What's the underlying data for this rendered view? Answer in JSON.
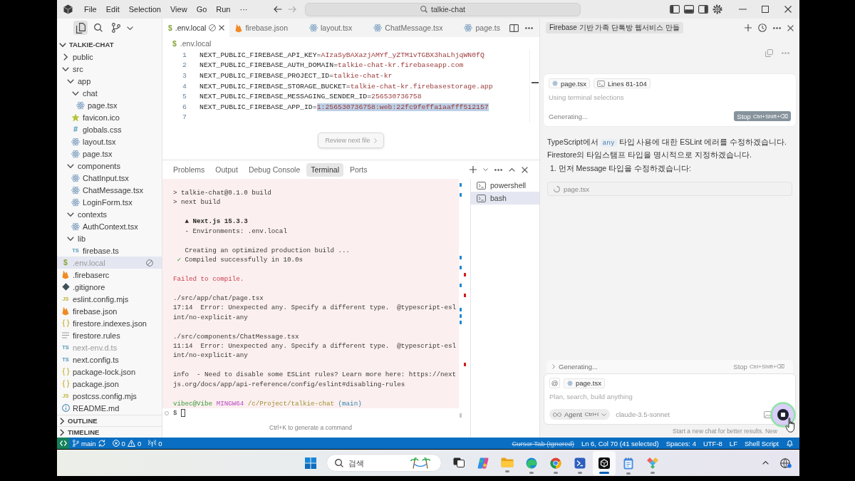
{
  "title_bar": {
    "menus": [
      "File",
      "Edit",
      "Selection",
      "View",
      "Go",
      "Run",
      "···"
    ],
    "command_center": {
      "label": "talkie-chat"
    }
  },
  "sidebar": {
    "views": [
      {
        "kind": "files",
        "selected": true
      },
      {
        "kind": "search",
        "selected": false
      },
      {
        "kind": "source-control",
        "selected": false
      }
    ],
    "explorer": {
      "title": "TALKIE-CHAT",
      "expanded": true,
      "items": [
        {
          "name": "public",
          "kind": "folder",
          "expanded": false,
          "selected": false,
          "dimmed": false,
          "blocked": false
        },
        {
          "name": "src",
          "kind": "folder",
          "expanded": true,
          "selected": false,
          "dimmed": false,
          "blocked": false,
          "children": [
            {
              "name": "app",
              "kind": "folder",
              "expanded": true,
              "selected": false,
              "dimmed": false,
              "blocked": false,
              "children": [
                {
                  "name": "chat",
                  "kind": "folder",
                  "expanded": true,
                  "selected": false,
                  "dimmed": false,
                  "blocked": false,
                  "children": [
                    {
                      "name": "page.tsx",
                      "kind": "react",
                      "selected": false,
                      "dimmed": false,
                      "blocked": false
                    }
                  ]
                },
                {
                  "name": "favicon.ico",
                  "kind": "star",
                  "selected": false,
                  "dimmed": false,
                  "blocked": false
                },
                {
                  "name": "globals.css",
                  "kind": "css",
                  "glyph": "#",
                  "selected": false,
                  "dimmed": false,
                  "blocked": false
                },
                {
                  "name": "layout.tsx",
                  "kind": "react",
                  "selected": false,
                  "dimmed": false,
                  "blocked": false
                },
                {
                  "name": "page.tsx",
                  "kind": "react",
                  "selected": false,
                  "dimmed": false,
                  "blocked": false
                }
              ]
            },
            {
              "name": "components",
              "kind": "folder",
              "expanded": true,
              "selected": false,
              "dimmed": false,
              "blocked": false,
              "children": [
                {
                  "name": "ChatInput.tsx",
                  "kind": "react",
                  "selected": false,
                  "dimmed": false,
                  "blocked": false
                },
                {
                  "name": "ChatMessage.tsx",
                  "kind": "react",
                  "selected": false,
                  "dimmed": false,
                  "blocked": false
                },
                {
                  "name": "LoginForm.tsx",
                  "kind": "react",
                  "selected": false,
                  "dimmed": false,
                  "blocked": false
                }
              ]
            },
            {
              "name": "contexts",
              "kind": "folder",
              "expanded": true,
              "selected": false,
              "dimmed": false,
              "blocked": false,
              "children": [
                {
                  "name": "AuthContext.tsx",
                  "kind": "react",
                  "selected": false,
                  "dimmed": false,
                  "blocked": false
                }
              ]
            },
            {
              "name": "lib",
              "kind": "folder",
              "expanded": true,
              "selected": false,
              "dimmed": false,
              "blocked": false,
              "children": [
                {
                  "name": "firebase.ts",
                  "kind": "ts",
                  "glyph": "TS",
                  "selected": false,
                  "dimmed": false,
                  "blocked": false
                }
              ]
            }
          ]
        },
        {
          "name": ".env.local",
          "kind": "env",
          "glyph": "$",
          "selected": true,
          "dimmed": true,
          "blocked": true
        },
        {
          "name": ".firebaserc",
          "kind": "firebase",
          "selected": false,
          "dimmed": false,
          "blocked": false
        },
        {
          "name": ".gitignore",
          "kind": "git",
          "selected": false,
          "dimmed": false,
          "blocked": false
        },
        {
          "name": "eslint.config.mjs",
          "kind": "js",
          "glyph": "JS",
          "selected": false,
          "dimmed": false,
          "blocked": false
        },
        {
          "name": "firebase.json",
          "kind": "firebase",
          "selected": false,
          "dimmed": false,
          "blocked": false
        },
        {
          "name": "firestore.indexes.json",
          "kind": "json",
          "selected": false,
          "dimmed": false,
          "blocked": false
        },
        {
          "name": "firestore.rules",
          "kind": "rules",
          "selected": false,
          "dimmed": false,
          "blocked": false
        },
        {
          "name": "next-env.d.ts",
          "kind": "ts",
          "glyph": "TS",
          "selected": false,
          "dimmed": true,
          "blocked": false
        },
        {
          "name": "next.config.ts",
          "kind": "ts",
          "glyph": "TS",
          "selected": false,
          "dimmed": false,
          "blocked": false
        },
        {
          "name": "package-lock.json",
          "kind": "json",
          "selected": false,
          "dimmed": false,
          "blocked": false
        },
        {
          "name": "package.json",
          "kind": "json",
          "selected": false,
          "dimmed": false,
          "blocked": false
        },
        {
          "name": "postcss.config.mjs",
          "kind": "js",
          "glyph": "JS",
          "selected": false,
          "dimmed": false,
          "blocked": false
        },
        {
          "name": "README.md",
          "kind": "info",
          "selected": false,
          "dimmed": false,
          "blocked": false
        }
      ]
    },
    "sections": [
      {
        "label": "OUTLINE",
        "expanded": false
      },
      {
        "label": "TIMELINE",
        "expanded": false
      }
    ]
  },
  "editor": {
    "tabs": [
      {
        "label": ".env.local",
        "kind": "env",
        "glyph": "$",
        "selected": true,
        "blocked": true
      },
      {
        "label": "firebase.json",
        "kind": "firebase",
        "selected": false,
        "blocked": false
      },
      {
        "label": "layout.tsx",
        "kind": "react",
        "selected": false,
        "blocked": false
      },
      {
        "label": "ChatMessage.tsx",
        "kind": "react",
        "selected": false,
        "blocked": false
      },
      {
        "label": "page.ts",
        "kind": "react",
        "selected": false,
        "blocked": false
      }
    ],
    "breadcrumb": {
      "kind": "env",
      "glyph": "$",
      "label": ".env.local"
    },
    "lines": [
      {
        "number": "1",
        "key": "NEXT_PUBLIC_FIREBASE_API_KEY=",
        "value": "AIzaSyBAXazjAMYf_yZTM1vTGBX3haLhjqWN0fQ",
        "selected": false
      },
      {
        "number": "2",
        "key": "NEXT_PUBLIC_FIREBASE_AUTH_DOMAIN=",
        "value": "talkie-chat-kr.firebaseapp.com",
        "selected": false
      },
      {
        "number": "3",
        "key": "NEXT_PUBLIC_FIREBASE_PROJECT_ID=",
        "value": "talkie-chat-kr",
        "selected": false
      },
      {
        "number": "4",
        "key": "NEXT_PUBLIC_FIREBASE_STORAGE_BUCKET=",
        "value": "talkie-chat-kr.firebasestorage.app",
        "selected": false
      },
      {
        "number": "5",
        "key": "NEXT_PUBLIC_FIREBASE_MESSAGING_SENDER_ID=",
        "value": "256530736758",
        "selected": false
      },
      {
        "number": "6",
        "key": "NEXT_PUBLIC_FIREBASE_APP_ID=",
        "value": "1:256530736758:web:22fc9feffa1aafff512157",
        "selected": true
      },
      {
        "number": "7",
        "selected": false
      }
    ],
    "review_button": {
      "label": "Review next file",
      "disabled": true
    }
  },
  "panel": {
    "tabs": [
      {
        "label": "Problems",
        "selected": false
      },
      {
        "label": "Output",
        "selected": false
      },
      {
        "label": "Debug Console",
        "selected": false
      },
      {
        "label": "Terminal",
        "selected": true
      },
      {
        "label": "Ports",
        "selected": false
      }
    ],
    "terminal": {
      "blocks": [
        {
          "lines": [
            {
              "segments": [
                {
                  "kind": "plain",
                  "text": "> talkie-chat@0.1.0 build"
                }
              ]
            },
            {
              "segments": [
                {
                  "kind": "plain",
                  "text": "> next build"
                }
              ]
            }
          ]
        },
        {
          "lines": [
            {
              "segments": [
                {
                  "kind": "bold",
                  "text": "   ▲ Next.js 15.3.3"
                }
              ]
            },
            {
              "segments": [
                {
                  "kind": "plain",
                  "text": "   - Environments: .env.local"
                }
              ]
            }
          ]
        },
        {
          "lines": [
            {
              "segments": [
                {
                  "kind": "plain",
                  "text": "   Creating an optimized production build ..."
                }
              ]
            },
            {
              "segments": [
                {
                  "kind": "success",
                  "text": " ✓"
                },
                {
                  "kind": "plain",
                  "text": " Compiled successfully in 10.0s"
                }
              ]
            }
          ]
        },
        {
          "lines": [
            {
              "segments": [
                {
                  "kind": "error",
                  "text": "Failed to compile."
                }
              ]
            }
          ]
        },
        {
          "lines": [
            {
              "segments": [
                {
                  "kind": "plain",
                  "text": "./src/app/chat/page.tsx"
                }
              ]
            },
            {
              "segments": [
                {
                  "kind": "plain",
                  "text": "17:14  Error: Unexpected any. Specify a different type.  @typescript-esl"
                }
              ]
            },
            {
              "segments": [
                {
                  "kind": "plain",
                  "text": "int/no-explicit-any"
                }
              ]
            }
          ]
        },
        {
          "lines": [
            {
              "segments": [
                {
                  "kind": "plain",
                  "text": "./src/components/ChatMessage.tsx"
                }
              ]
            },
            {
              "segments": [
                {
                  "kind": "plain",
                  "text": "11:14  Error: Unexpected any. Specify a different type.  @typescript-esl"
                }
              ]
            },
            {
              "segments": [
                {
                  "kind": "plain",
                  "text": "int/no-explicit-any"
                }
              ]
            }
          ]
        },
        {
          "lines": [
            {
              "segments": [
                {
                  "kind": "plain",
                  "text": "info  - Need to disable some ESLint rules? Learn more here: https://next"
                }
              ]
            },
            {
              "segments": [
                {
                  "kind": "plain",
                  "text": "js.org/docs/app/api-reference/config/eslint#disabling-rules"
                }
              ]
            }
          ]
        },
        {
          "lines": [
            {
              "segments": [
                {
                  "kind": "user",
                  "text": "vibec@Vibe"
                },
                {
                  "kind": "host",
                  "text": " MINGW64"
                },
                {
                  "kind": "path",
                  "text": " /c/Project/talkie-chat"
                },
                {
                  "kind": "branch",
                  "text": " (main)"
                }
              ]
            }
          ]
        }
      ],
      "prompt": "$",
      "hint": "Ctrl+K to generate a command"
    },
    "sessions": [
      {
        "label": "powershell",
        "selected": false
      },
      {
        "label": "bash",
        "selected": true
      }
    ]
  },
  "chat": {
    "title": "Firebase 기반 가족 단톡방 웹서비스 만들",
    "request": {
      "chips": [
        {
          "kind": "file",
          "label": "page.tsx"
        },
        {
          "kind": "selection",
          "label": "Lines 81-104"
        }
      ],
      "note": "Using terminal selections",
      "status": "Generating...",
      "stop": {
        "kind": "filled",
        "label": "Stop",
        "shortcut": "Ctrl+Shift+⌫"
      }
    },
    "reply": {
      "paragraph": [
        {
          "kind": "text",
          "text": "TypeScript에서 "
        },
        {
          "kind": "code",
          "text": "any"
        },
        {
          "kind": "text",
          "text": " 타입 사용에 대한 ESLint 에러를 수정하겠습니다. Firestore의 타임스탬프 타입을 명시적으로 지정하겠습니다."
        }
      ],
      "step": "1. 먼저 Message 타입을 수정하겠습니다:",
      "file": {
        "label": "page.tsx",
        "loading": true
      }
    },
    "composer": {
      "status": "Generating...",
      "stop": {
        "kind": "ghost",
        "label": "Stop",
        "shortcut": "Ctrl+Shift+⌫"
      },
      "mention": "@",
      "chips": [
        {
          "kind": "file",
          "label": "page.tsx"
        }
      ],
      "placeholder": "Plan, search, build anything",
      "mode": {
        "label": "Agent",
        "shortcut": "Ctrl+I"
      },
      "model": "claude-3.5-sonnet",
      "footer": "Start a new chat for better results. New"
    }
  },
  "status_bar": {
    "branch": "main",
    "errors": "0",
    "warnings": "0",
    "ports": "0",
    "items": [
      {
        "label": "Cursor Tab (Ignored)",
        "disabled": true
      },
      {
        "label": "Ln 6, Col 70 (41 selected)",
        "disabled": false
      },
      {
        "label": "Spaces: 4",
        "disabled": false
      },
      {
        "label": "UTF-8",
        "disabled": false
      },
      {
        "label": "LF",
        "disabled": false
      },
      {
        "label": "Shell Script",
        "disabled": false
      }
    ]
  },
  "taskbar": {
    "search": {
      "placeholder": "검색"
    },
    "apps": [
      {
        "kind": "task-view",
        "running": false,
        "selected": false
      },
      {
        "kind": "copilot",
        "running": false,
        "selected": false
      },
      {
        "kind": "files",
        "running": true,
        "selected": false
      },
      {
        "kind": "edge",
        "running": true,
        "selected": false
      },
      {
        "kind": "chrome",
        "running": true,
        "selected": false
      },
      {
        "kind": "terminal",
        "running": true,
        "selected": false
      },
      {
        "kind": "cursor",
        "running": true,
        "selected": true
      },
      {
        "kind": "notepad",
        "running": true,
        "selected": false
      },
      {
        "kind": "diamond",
        "running": true,
        "selected": false
      }
    ]
  }
}
